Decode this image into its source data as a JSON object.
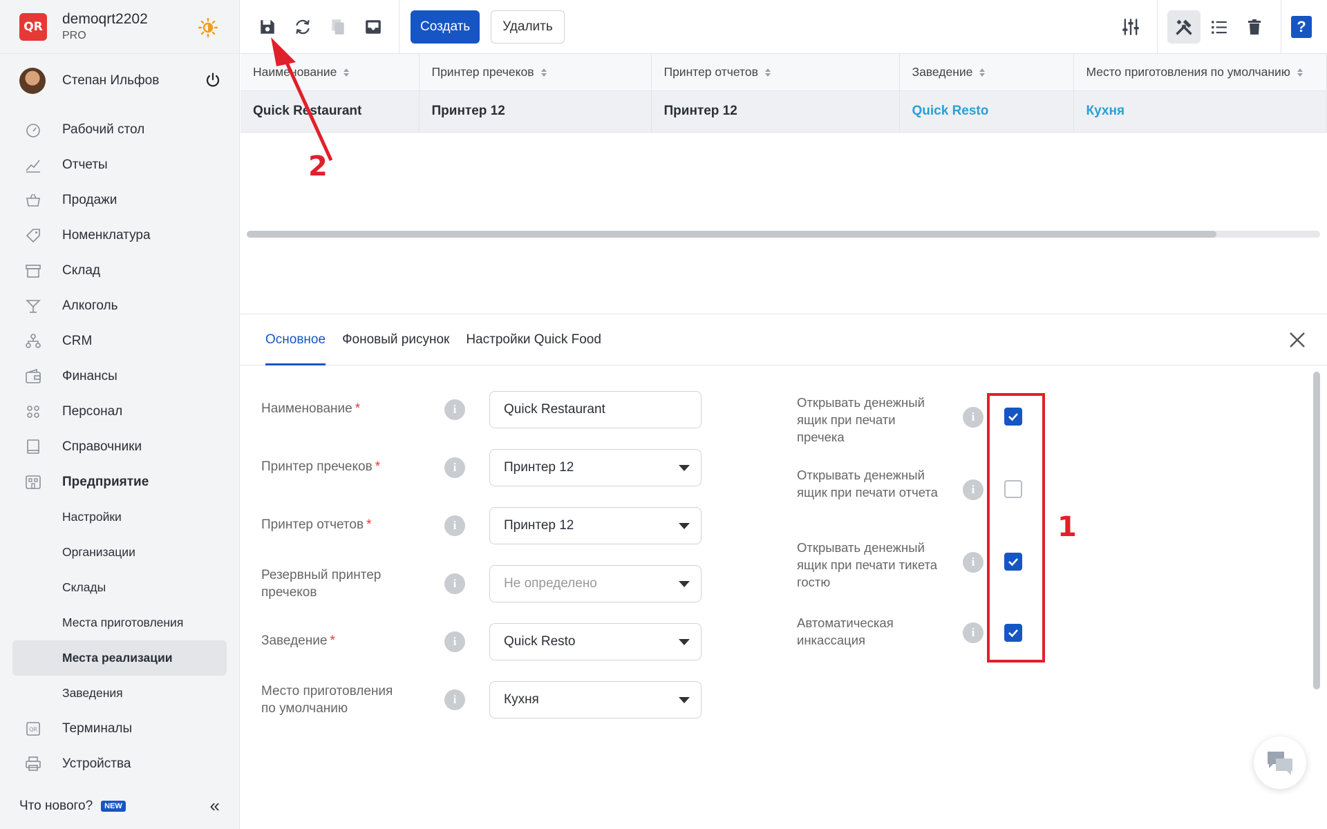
{
  "sidebar": {
    "account": {
      "name": "demoqrt2202",
      "plan": "PRO",
      "logo": "QR"
    },
    "user": {
      "name": "Степан Ильфов"
    },
    "items": [
      {
        "label": "Рабочий стол",
        "icon": "dashboard-icon"
      },
      {
        "label": "Отчеты",
        "icon": "reports-icon"
      },
      {
        "label": "Продажи",
        "icon": "basket-icon"
      },
      {
        "label": "Номенклатура",
        "icon": "tag-icon"
      },
      {
        "label": "Склад",
        "icon": "warehouse-icon"
      },
      {
        "label": "Алкоголь",
        "icon": "cocktail-icon"
      },
      {
        "label": "CRM",
        "icon": "crm-icon"
      },
      {
        "label": "Финансы",
        "icon": "wallet-icon"
      },
      {
        "label": "Персонал",
        "icon": "staff-icon"
      },
      {
        "label": "Справочники",
        "icon": "book-icon"
      },
      {
        "label": "Предприятие",
        "icon": "enterprise-icon"
      }
    ],
    "sub_items": [
      "Настройки",
      "Организации",
      "Склады",
      "Места приготовления",
      "Места реализации",
      "Заведения"
    ],
    "bottom_items": [
      {
        "label": "Терминалы",
        "icon": "terminal-icon"
      },
      {
        "label": "Устройства",
        "icon": "printer-icon"
      }
    ],
    "footer": {
      "whats_new": "Что нового?",
      "badge": "NEW"
    }
  },
  "toolbar": {
    "create_label": "Создать",
    "delete_label": "Удалить"
  },
  "table": {
    "headers": [
      "Наименование",
      "Принтер пречеков",
      "Принтер отчетов",
      "Заведение",
      "Место приготовления по умолчанию"
    ],
    "rows": [
      [
        "Quick Restaurant",
        "Принтер 12",
        "Принтер 12",
        "Quick Resto",
        "Кухня"
      ]
    ]
  },
  "tabs": [
    "Основное",
    "Фоновый рисунок",
    "Настройки Quick Food"
  ],
  "form": {
    "fields": [
      {
        "label": "Наименование",
        "required": "*",
        "value": "Quick Restaurant"
      },
      {
        "label": "Принтер пречеков",
        "required": "*",
        "value": "Принтер 12"
      },
      {
        "label": "Принтер отчетов",
        "required": "*",
        "value": "Принтер 12"
      },
      {
        "label": "Резервный принтер пречеков",
        "required": "",
        "value": "Не определено"
      },
      {
        "label": "Заведение",
        "required": "*",
        "value": "Quick Resto"
      },
      {
        "label": "Место приготовления по умолчанию",
        "required": "",
        "value": "Кухня"
      }
    ],
    "checkboxes": [
      {
        "label": "Открывать денежный ящик при печати пречека",
        "checked": true
      },
      {
        "label": "Открывать денежный ящик при печати отчета",
        "checked": false
      },
      {
        "label": "Открывать денежный ящик при печати тикета гостю",
        "checked": true
      },
      {
        "label": "Автоматическая инкассация",
        "checked": true
      }
    ]
  },
  "annotations": {
    "one": "1",
    "two": "2"
  },
  "colors": {
    "accent": "#1556c4",
    "link": "#2a9fd6",
    "annotation": "#e0202a",
    "logo": "#e53935"
  }
}
